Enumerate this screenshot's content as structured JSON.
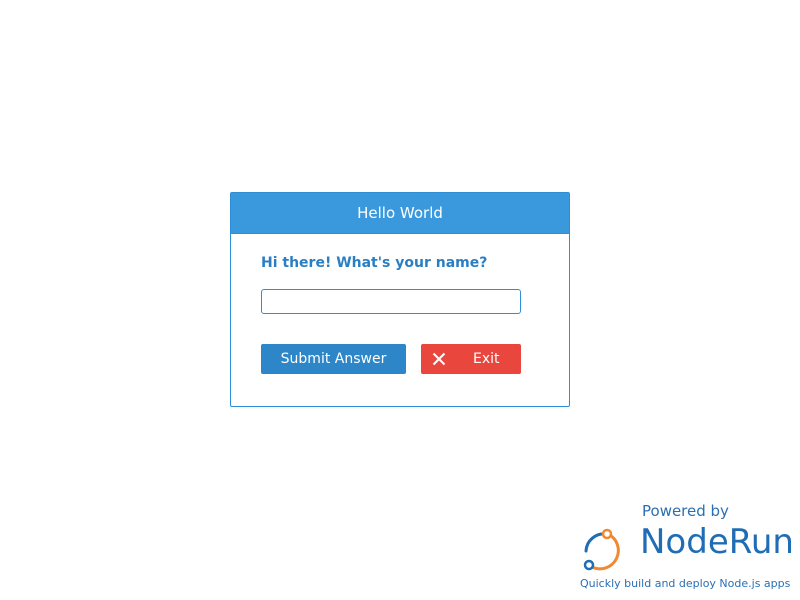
{
  "dialog": {
    "title": "Hello World",
    "question": "Hi there! What's your name?",
    "input_value": "",
    "input_placeholder": "",
    "submit_label": "Submit Answer",
    "exit_label": "Exit",
    "exit_icon": "close-icon"
  },
  "badge": {
    "powered_by": "Powered by",
    "brand": "NodeRun",
    "tagline": "Quickly build and deploy Node.js apps",
    "logo_icon": "noderun-logo-icon"
  },
  "colors": {
    "header_bg": "#3a99dd",
    "accent": "#2c86c8",
    "danger": "#e9473e",
    "brand_blue": "#1f6db5",
    "brand_orange": "#f0892f"
  }
}
